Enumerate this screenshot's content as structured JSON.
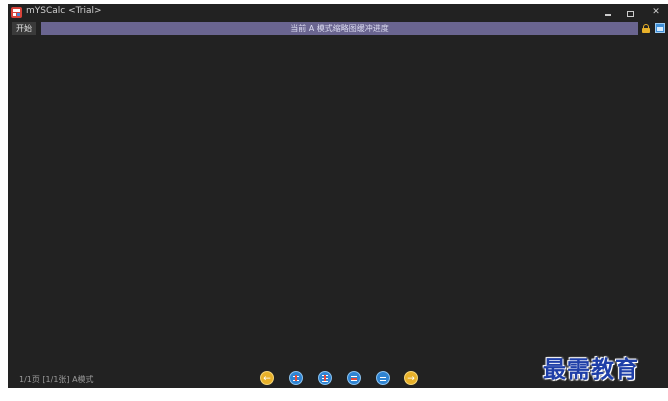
{
  "window": {
    "title": "mYSCalc <Trial>"
  },
  "menu": {
    "start_label": "开始"
  },
  "status": {
    "text": "当前 A 模式缩略图缓冲进度"
  },
  "footer": {
    "page_info": "1/1页 [1/1张] A模式",
    "nav_buttons": [
      {
        "icon": "arrow-left-icon",
        "glyph": "←"
      },
      {
        "icon": "fit-width-icon"
      },
      {
        "icon": "fit-height-icon"
      },
      {
        "icon": "fit-page-icon"
      },
      {
        "icon": "actual-size-icon"
      },
      {
        "icon": "arrow-right-icon",
        "glyph": "→"
      }
    ]
  },
  "watermark": {
    "text": "最需教育"
  },
  "colors": {
    "background": "#222222",
    "status_bar": "#6a6590",
    "accent_yellow": "#e8b12a",
    "accent_blue": "#2f84d2",
    "watermark": "#1f3fa8"
  }
}
